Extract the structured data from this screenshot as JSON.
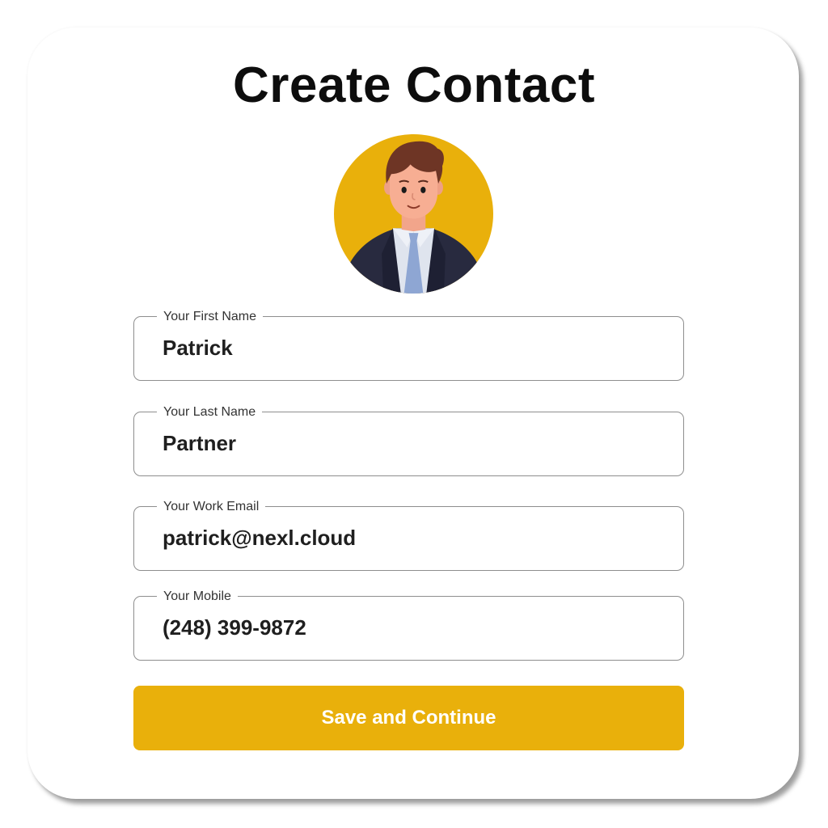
{
  "form": {
    "title": "Create Contact",
    "avatar_icon": "user-avatar-icon",
    "fields": [
      {
        "label": "Your First Name",
        "value": "Patrick"
      },
      {
        "label": "Your Last Name",
        "value": "Partner"
      },
      {
        "label": "Your Work Email",
        "value": "patrick@nexl.cloud"
      },
      {
        "label": "Your Mobile",
        "value": "(248) 399-9872"
      }
    ],
    "submit_label": "Save and Continue"
  },
  "colors": {
    "accent": "#e9b00b",
    "text": "#0d0d0d",
    "border": "#8e8e8e",
    "background": "#ffffff"
  }
}
